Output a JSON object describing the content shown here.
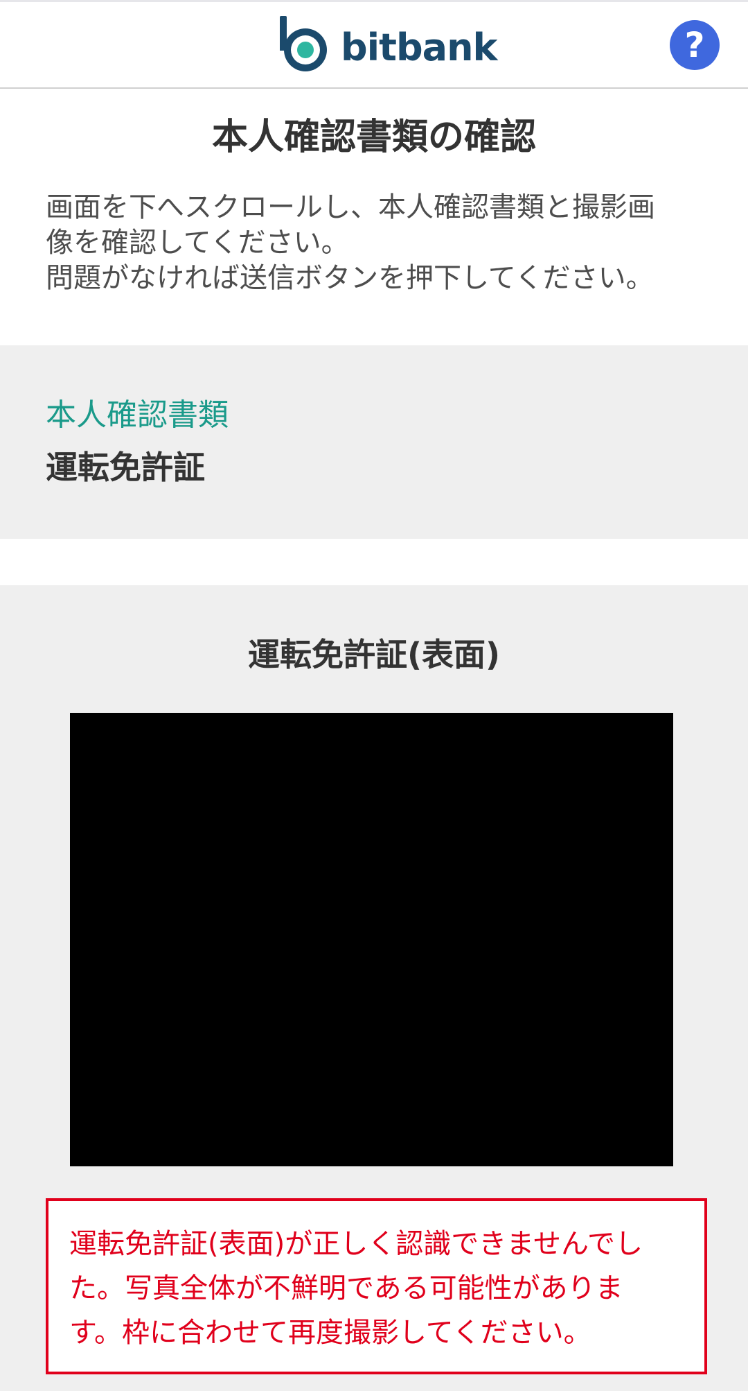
{
  "header": {
    "logo_text": "bitbank",
    "help_symbol": "?",
    "brand_colors": {
      "logo_dark": "#1b4a6c",
      "logo_teal": "#2eb6a0",
      "help": "#3f68de"
    },
    "help_icon": "question-circle-icon"
  },
  "main": {
    "title": "本人確認書類の確認",
    "instructions": [
      "画面を下へスクロールし、本人確認書類と撮影画",
      "像を確認してください。",
      "問題がなければ送信ボタンを押下してください。"
    ]
  },
  "document": {
    "label": "本人確認書類",
    "value": "運転免許証",
    "label_color": "#1a9a8a"
  },
  "photo": {
    "title": "運転免許証(表面)",
    "error_lines": [
      "運転免許証(表面)が正しく認識できませんでし",
      "た。写真全体が不鮮明である可能性がありま",
      "す。枠に合わせて再度撮影してください。"
    ],
    "error_color": "#e0001b"
  }
}
